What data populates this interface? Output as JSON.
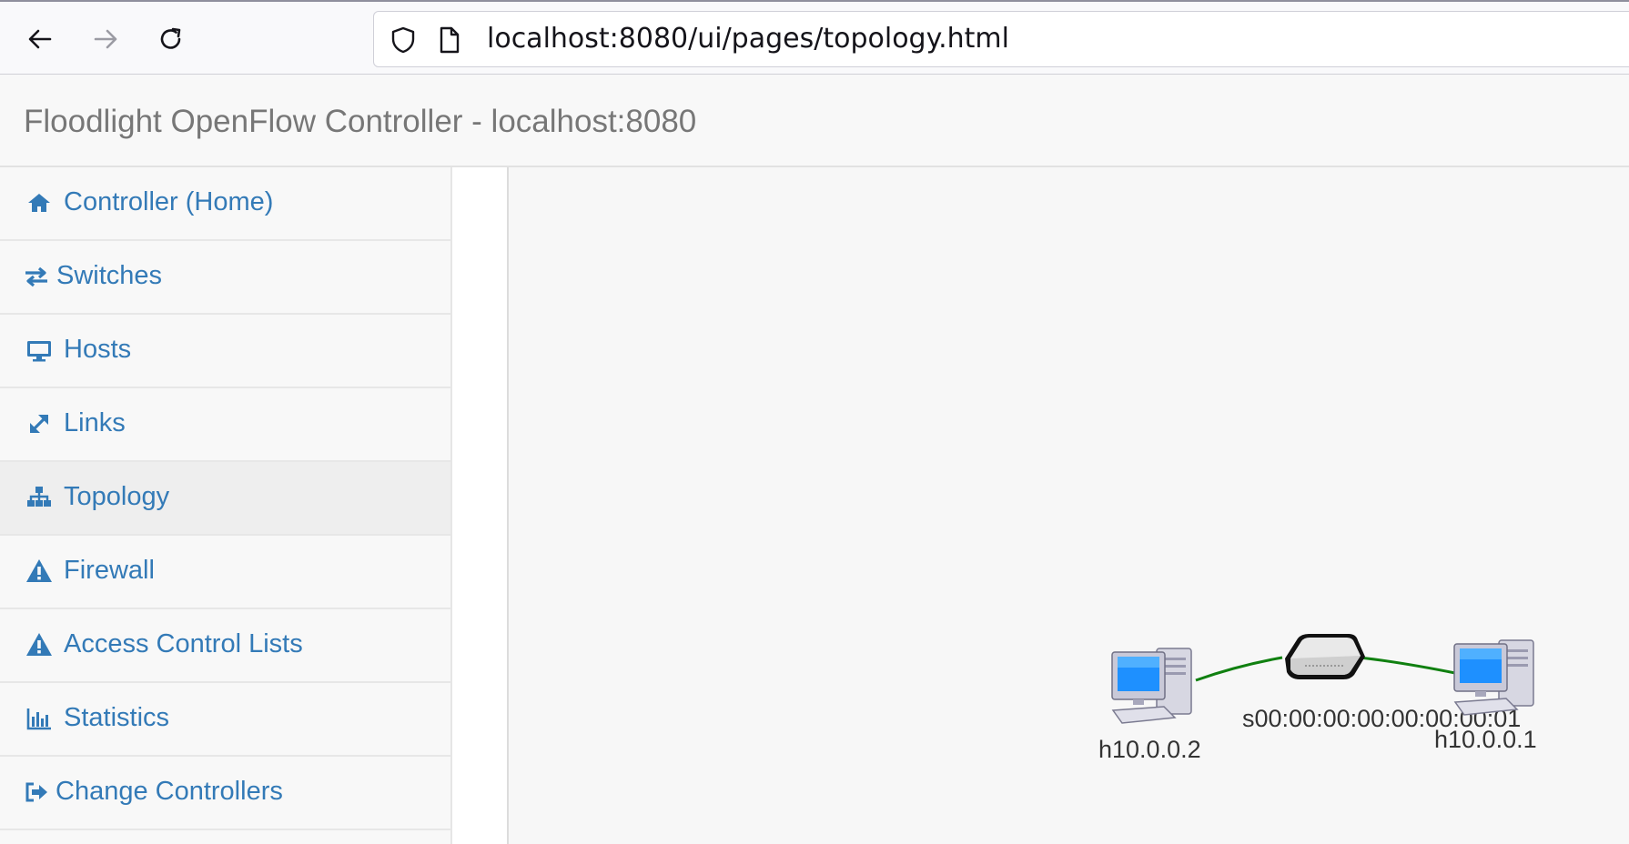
{
  "browser": {
    "url": "localhost:8080/ui/pages/topology.html"
  },
  "app": {
    "title": "Floodlight OpenFlow Controller - localhost:8080"
  },
  "sidebar": {
    "items": [
      {
        "label": "Controller (Home)",
        "icon": "home-icon"
      },
      {
        "label": "Switches",
        "icon": "exchange-icon"
      },
      {
        "label": "Hosts",
        "icon": "desktop-icon"
      },
      {
        "label": "Links",
        "icon": "resize-icon"
      },
      {
        "label": "Topology",
        "icon": "sitemap-icon",
        "active": true
      },
      {
        "label": "Firewall",
        "icon": "warning-icon"
      },
      {
        "label": "Access Control Lists",
        "icon": "warning-icon"
      },
      {
        "label": "Statistics",
        "icon": "bar-chart-icon"
      },
      {
        "label": "Change Controllers",
        "icon": "sign-out-icon"
      }
    ]
  },
  "topology": {
    "switch_label": "s00:00:00:00:00:00:00:01",
    "host_left_label": "h10.0.0.2",
    "host_right_label": "h10.0.0.1",
    "link_color": "#108010"
  },
  "colors": {
    "link": "#337ab7",
    "brand": "#777777"
  }
}
